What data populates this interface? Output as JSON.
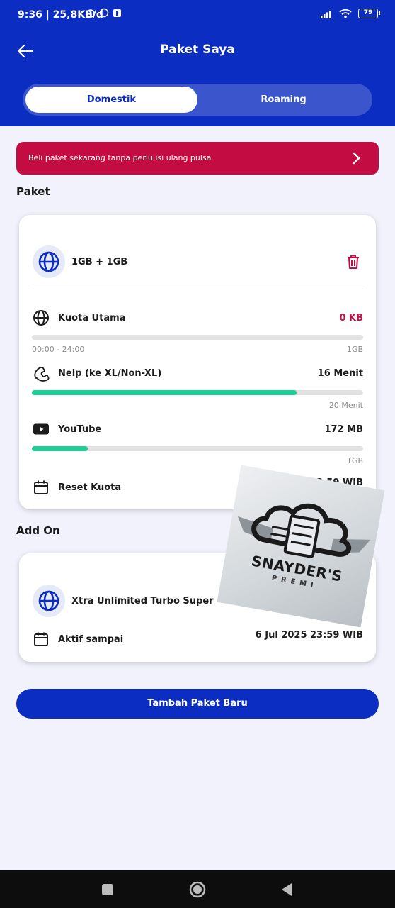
{
  "status_bar": {
    "time": "9:36 | 25,8KB/d",
    "battery": "79"
  },
  "header": {
    "title": "Paket Saya",
    "tabs": [
      {
        "label": "Domestik",
        "active": true
      },
      {
        "label": "Roaming",
        "active": false
      }
    ]
  },
  "promo": {
    "text": "Beli paket sekarang tanpa perlu isi ulang pulsa"
  },
  "paket_section": {
    "title": "Paket",
    "package_name": "1GB + 1GB",
    "rows": {
      "kuota_utama": {
        "label": "Kuota Utama",
        "value": "0 KB",
        "time_range": "00:00 - 24:00",
        "total": "1GB",
        "used_fraction": 0.0
      },
      "nelp": {
        "label": "Nelp (ke XL/Non-XL)",
        "value": "16 Menit",
        "total": "20 Menit",
        "remaining_fraction": 0.8
      },
      "youtube": {
        "label": "YouTube",
        "value": "172 MB",
        "total": "1GB",
        "remaining_fraction": 0.168
      },
      "reset": {
        "label": "Reset Kuota",
        "value": "5 23:59 WIB"
      }
    }
  },
  "addon_section": {
    "title": "Add On",
    "addon_name": "Xtra Unlimited Turbo Super",
    "active_label": "Aktif sampai",
    "active_value": "6 Jul 2025 23:59 WIB"
  },
  "watermark": {
    "title": "SNAYDER'S",
    "subtitle": "PREMI"
  },
  "cta": {
    "label": "Tambah Paket Baru"
  },
  "colors": {
    "brand_blue": "#0c2dc2",
    "promo_red": "#c30c41",
    "progress_green": "#1dcf95",
    "trash_red": "#c30c41"
  },
  "icons": [
    "back-arrow-icon",
    "chevron-right-icon",
    "globe-icon",
    "trash-icon",
    "phone-icon",
    "youtube-icon",
    "calendar-icon",
    "square-icon",
    "circle-icon",
    "triangle-icon"
  ]
}
